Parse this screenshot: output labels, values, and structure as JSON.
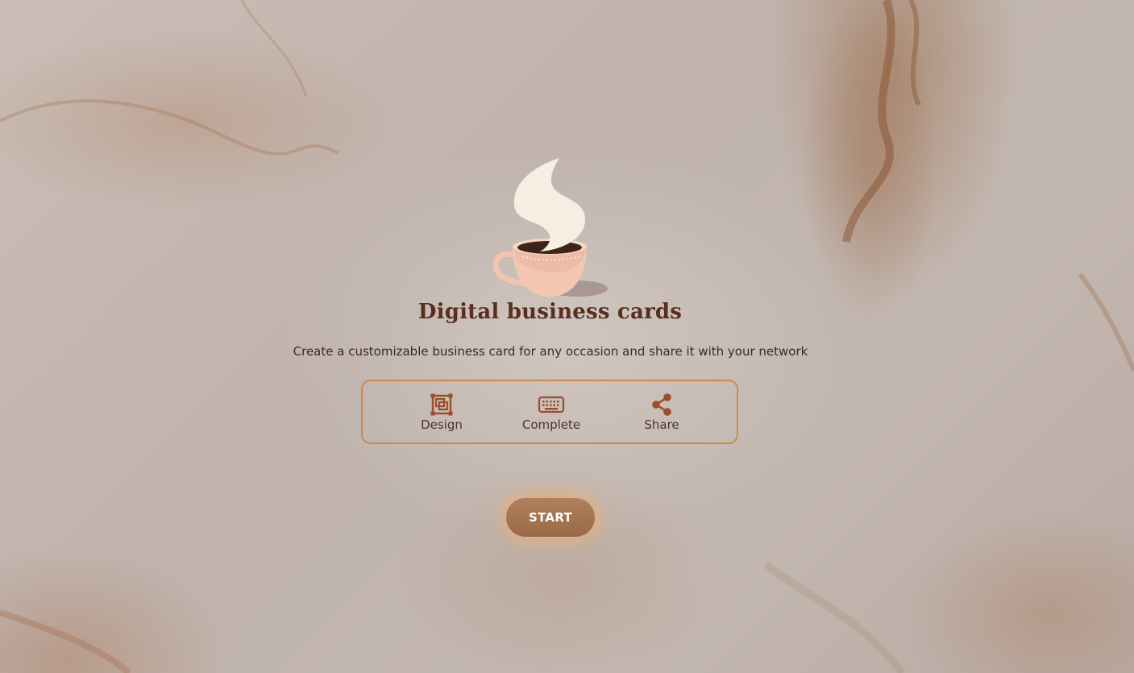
{
  "hero": {
    "title": "Digital business cards",
    "subtitle": "Create a customizable business card for any occasion and share it with your network"
  },
  "steps": [
    {
      "label": "Design",
      "icon": "design-frame-icon"
    },
    {
      "label": "Complete",
      "icon": "keyboard-icon"
    },
    {
      "label": "Share",
      "icon": "share-icon"
    }
  ],
  "start_button": {
    "label": "START"
  },
  "colors": {
    "accent": "#c98a4e",
    "title": "#5a2e1e",
    "icon": "#9a4e2a",
    "button": "#a9764f"
  }
}
